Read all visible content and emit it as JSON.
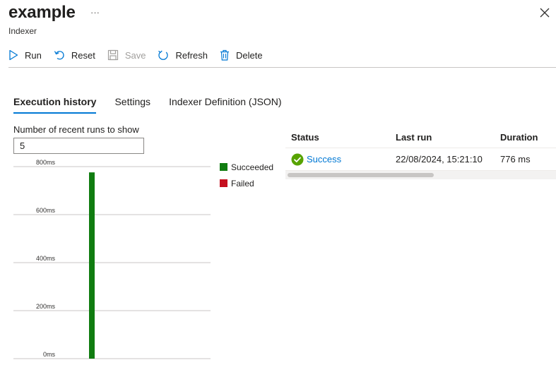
{
  "header": {
    "title": "example",
    "more_label": "···",
    "subtitle": "Indexer"
  },
  "toolbar": {
    "run_label": "Run",
    "reset_label": "Reset",
    "save_label": "Save",
    "refresh_label": "Refresh",
    "delete_label": "Delete"
  },
  "tabs": [
    {
      "label": "Execution history",
      "active": true
    },
    {
      "label": "Settings",
      "active": false
    },
    {
      "label": "Indexer Definition (JSON)",
      "active": false
    }
  ],
  "runs": {
    "label": "Number of recent runs to show",
    "value": "5"
  },
  "legend": {
    "succeeded": "Succeeded",
    "failed": "Failed"
  },
  "table": {
    "headers": [
      "Status",
      "Last run",
      "Duration"
    ],
    "rows": [
      {
        "status": "Success",
        "last_run": "22/08/2024, 15:21:10",
        "duration": "776 ms"
      }
    ],
    "scroll_fraction": 0.55
  },
  "colors": {
    "accent": "#0078d4",
    "succeeded": "#107c10",
    "failed": "#c50f1f",
    "success_icon": "#57a300"
  },
  "chart_data": {
    "type": "bar",
    "yticks": [
      "800ms",
      "600ms",
      "400ms",
      "200ms",
      "0ms"
    ],
    "ylim": [
      0,
      800
    ],
    "series": [
      {
        "name": "Succeeded",
        "values": [
          776
        ]
      },
      {
        "name": "Failed",
        "values": [
          0
        ]
      }
    ],
    "grid": true,
    "legend_position": "right"
  }
}
